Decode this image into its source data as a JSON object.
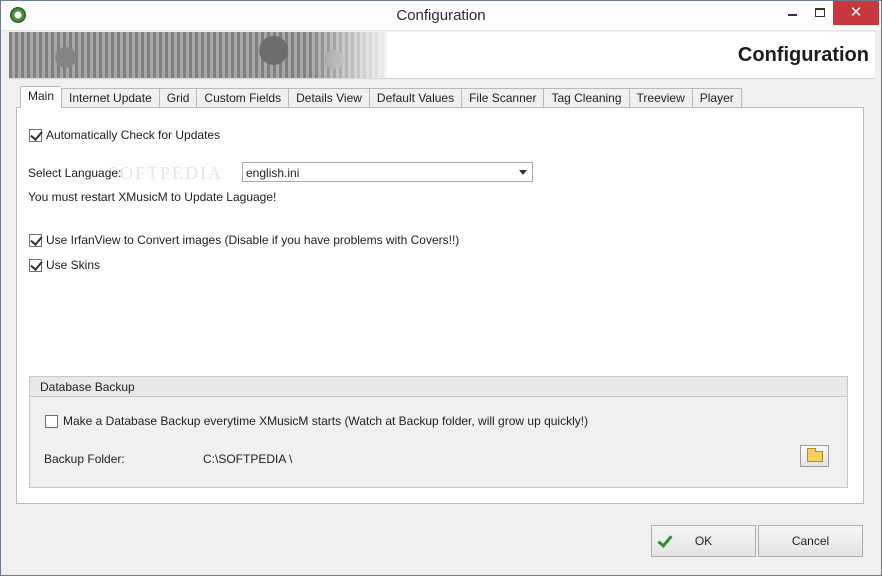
{
  "window": {
    "title": "Configuration",
    "controls": {
      "minimize": "minimize-icon",
      "maximize": "maximize-icon",
      "close": "✕"
    }
  },
  "banner": {
    "title": "Configuration"
  },
  "tabs": [
    {
      "label": "Main",
      "active": true
    },
    {
      "label": "Internet Update"
    },
    {
      "label": "Grid"
    },
    {
      "label": "Custom Fields"
    },
    {
      "label": "Details View"
    },
    {
      "label": "Default Values"
    },
    {
      "label": "File Scanner"
    },
    {
      "label": "Tag Cleaning"
    },
    {
      "label": "Treeview"
    },
    {
      "label": "Player"
    }
  ],
  "main": {
    "auto_update": {
      "label": "Automatically Check for Updates",
      "checked": true
    },
    "language": {
      "label": "Select Language:",
      "value": "english.ini",
      "note": "You must restart XMusicM to Update Laguage!"
    },
    "irfanview": {
      "label": "Use IrfanView to Convert images (Disable if you have problems with Covers!!)",
      "checked": true
    },
    "skins": {
      "label": "Use Skins",
      "checked": true
    }
  },
  "backup": {
    "title": "Database Backup",
    "auto_backup": {
      "label": "Make a Database Backup everytime XMusicM starts (Watch at Backup folder, will grow up quickly!)",
      "checked": false
    },
    "folder_label": "Backup Folder:",
    "folder_value": "C:\\SOFTPEDIA \\"
  },
  "buttons": {
    "ok": "OK",
    "cancel": "Cancel"
  },
  "watermark": "SOFTPEDIA"
}
